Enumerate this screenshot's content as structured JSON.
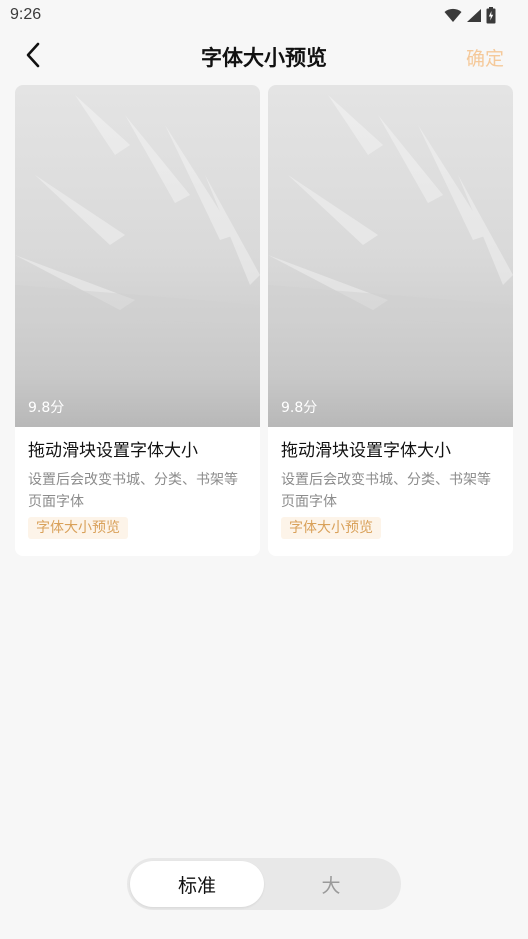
{
  "status_bar": {
    "time": "9:26",
    "icons": [
      "wifi-icon",
      "cellular-icon",
      "battery-icon"
    ]
  },
  "nav": {
    "title": "字体大小预览",
    "confirm_label": "确定",
    "back_icon": "chevron-left-icon"
  },
  "cards": [
    {
      "score": "9.8分",
      "title": "拖动滑块设置字体大小",
      "description": "设置后会改变书城、分类、书架等页面字体",
      "tag": "字体大小预览"
    },
    {
      "score": "9.8分",
      "title": "拖动滑块设置字体大小",
      "description": "设置后会改变书城、分类、书架等页面字体",
      "tag": "字体大小预览"
    }
  ],
  "font_size_selector": {
    "options": [
      "标准",
      "大"
    ],
    "selected": "标准"
  },
  "colors": {
    "accent": "#F5C99A",
    "tag_text": "#D9A15A",
    "tag_bg": "#FDF4E9",
    "background": "#F7F7F7"
  }
}
